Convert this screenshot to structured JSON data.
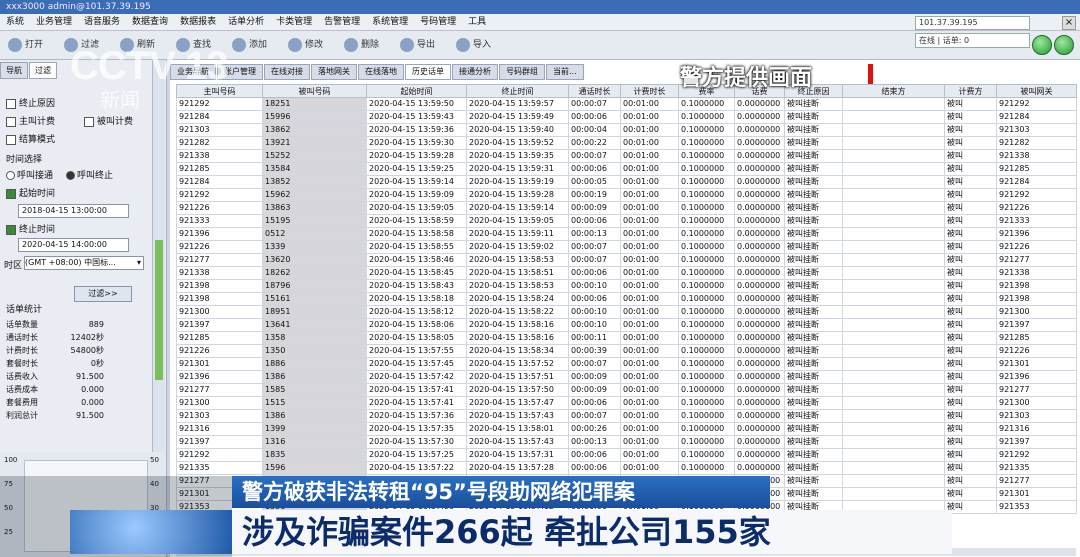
{
  "window": {
    "title": "xxx3000 admin@101.37.39.195",
    "ip": "101.37.39.195",
    "status": "在线 | 话单: 0"
  },
  "menu": [
    "系统",
    "业务管理",
    "语音服务",
    "数据查询",
    "数据报表",
    "话单分析",
    "卡类管理",
    "告警管理",
    "系统管理",
    "号码管理",
    "工具"
  ],
  "toolbar": [
    {
      "label": "打开",
      "icon": "open-icon"
    },
    {
      "label": "过滤",
      "icon": "filter-icon"
    },
    {
      "label": "刷新",
      "icon": "refresh-icon"
    },
    {
      "label": "查找",
      "icon": "search-icon"
    },
    {
      "label": "添加",
      "icon": "add-icon"
    },
    {
      "label": "修改",
      "icon": "edit-icon"
    },
    {
      "label": "删除",
      "icon": "delete-icon"
    },
    {
      "label": "导出",
      "icon": "export-icon"
    },
    {
      "label": "导入",
      "icon": "import-icon"
    }
  ],
  "left": {
    "tabs": [
      "导航",
      "过滤"
    ],
    "checks": [
      {
        "label": "终止原因",
        "checked": false
      },
      {
        "label": "主叫计费",
        "checked": false
      },
      {
        "label": "被叫计费",
        "checked": false
      },
      {
        "label": "结算模式",
        "checked": false
      }
    ],
    "time_section": "时间选择",
    "radios": [
      {
        "label": "呼叫接通",
        "on": false
      },
      {
        "label": "呼叫终止",
        "on": true
      }
    ],
    "start_label": "起始时间",
    "start_value": "2018-04-15 13:00:00",
    "end_label": "终止时间",
    "end_value": "2020-04-15 14:00:00",
    "tz_label": "时区",
    "tz_value": "(GMT +08:00) 中国标...",
    "filter_button": "过滤>>",
    "stats_title": "话单统计",
    "stats": [
      {
        "k": "话单数量",
        "v": "889"
      },
      {
        "k": "通话时长",
        "v": "12402秒"
      },
      {
        "k": "计费时长",
        "v": "54800秒"
      },
      {
        "k": "套餐时长",
        "v": "0秒"
      },
      {
        "k": "话费收入",
        "v": "91.500"
      },
      {
        "k": "话费成本",
        "v": "0.000"
      },
      {
        "k": "套餐费用",
        "v": "0.000"
      },
      {
        "k": "利润总计",
        "v": "91.500"
      }
    ],
    "gauge_left": [
      "100",
      "75",
      "50",
      "25"
    ],
    "gauge_right": [
      "50",
      "40",
      "30",
      "20"
    ]
  },
  "main": {
    "tabs": [
      "业务导航",
      "账户管理",
      "在线对接",
      "落地网关",
      "在线落地",
      "历史话单",
      "接通分析",
      "号码群组",
      "当前..."
    ],
    "active_tab": 5,
    "headers": [
      "主叫号码",
      "被叫号码",
      "起始时间",
      "终止时间",
      "通话时长",
      "计费时长",
      "费率",
      "话费",
      "终止原因",
      "结束方",
      "计费方",
      "主叫网关",
      "被叫网关"
    ],
    "rows": [
      [
        "921292",
        "18251",
        "2020-04-15 13:59:50",
        "2020-04-15 13:59:57",
        "00:00:07",
        "00:01:00",
        "0.1000000",
        "0.0000000",
        "被叫挂断",
        "",
        "被叫",
        "921292"
      ],
      [
        "921284",
        "15996",
        "2020-04-15 13:59:43",
        "2020-04-15 13:59:49",
        "00:00:06",
        "00:01:00",
        "0.1000000",
        "0.0000000",
        "被叫挂断",
        "",
        "被叫",
        "921284"
      ],
      [
        "921303",
        "13862",
        "2020-04-15 13:59:36",
        "2020-04-15 13:59:40",
        "00:00:04",
        "00:01:00",
        "0.1000000",
        "0.0000000",
        "被叫挂断",
        "",
        "被叫",
        "921303"
      ],
      [
        "921282",
        "13921",
        "2020-04-15 13:59:30",
        "2020-04-15 13:59:52",
        "00:00:22",
        "00:01:00",
        "0.1000000",
        "0.0000000",
        "被叫挂断",
        "",
        "被叫",
        "921282"
      ],
      [
        "921338",
        "15252",
        "2020-04-15 13:59:28",
        "2020-04-15 13:59:35",
        "00:00:07",
        "00:01:00",
        "0.1000000",
        "0.0000000",
        "被叫挂断",
        "",
        "被叫",
        "921338"
      ],
      [
        "921285",
        "13584",
        "2020-04-15 13:59:25",
        "2020-04-15 13:59:31",
        "00:00:06",
        "00:01:00",
        "0.1000000",
        "0.0000000",
        "被叫挂断",
        "",
        "被叫",
        "921285"
      ],
      [
        "921284",
        "13852",
        "2020-04-15 13:59:14",
        "2020-04-15 13:59:19",
        "00:00:05",
        "00:01:00",
        "0.1000000",
        "0.0000000",
        "被叫挂断",
        "",
        "被叫",
        "921284"
      ],
      [
        "921292",
        "15962",
        "2020-04-15 13:59:09",
        "2020-04-15 13:59:28",
        "00:00:19",
        "00:01:00",
        "0.1000000",
        "0.0000000",
        "被叫挂断",
        "",
        "被叫",
        "921292"
      ],
      [
        "921226",
        "13863",
        "2020-04-15 13:59:05",
        "2020-04-15 13:59:14",
        "00:00:09",
        "00:01:00",
        "0.1000000",
        "0.0000000",
        "被叫挂断",
        "",
        "被叫",
        "921226"
      ],
      [
        "921333",
        "15195",
        "2020-04-15 13:58:59",
        "2020-04-15 13:59:05",
        "00:00:06",
        "00:01:00",
        "0.1000000",
        "0.0000000",
        "被叫挂断",
        "",
        "被叫",
        "921333"
      ],
      [
        "921396",
        "0512",
        "2020-04-15 13:58:58",
        "2020-04-15 13:59:11",
        "00:00:13",
        "00:01:00",
        "0.1000000",
        "0.0000000",
        "被叫挂断",
        "",
        "被叫",
        "921396"
      ],
      [
        "921226",
        "1339",
        "2020-04-15 13:58:55",
        "2020-04-15 13:59:02",
        "00:00:07",
        "00:01:00",
        "0.1000000",
        "0.0000000",
        "被叫挂断",
        "",
        "被叫",
        "921226"
      ],
      [
        "921277",
        "13620",
        "2020-04-15 13:58:46",
        "2020-04-15 13:58:53",
        "00:00:07",
        "00:01:00",
        "0.1000000",
        "0.0000000",
        "被叫挂断",
        "",
        "被叫",
        "921277"
      ],
      [
        "921338",
        "18262",
        "2020-04-15 13:58:45",
        "2020-04-15 13:58:51",
        "00:00:06",
        "00:01:00",
        "0.1000000",
        "0.0000000",
        "被叫挂断",
        "",
        "被叫",
        "921338"
      ],
      [
        "921398",
        "18796",
        "2020-04-15 13:58:43",
        "2020-04-15 13:58:53",
        "00:00:10",
        "00:01:00",
        "0.1000000",
        "0.0000000",
        "被叫挂断",
        "",
        "被叫",
        "921398"
      ],
      [
        "921398",
        "15161",
        "2020-04-15 13:58:18",
        "2020-04-15 13:58:24",
        "00:00:06",
        "00:01:00",
        "0.1000000",
        "0.0000000",
        "被叫挂断",
        "",
        "被叫",
        "921398"
      ],
      [
        "921300",
        "18951",
        "2020-04-15 13:58:12",
        "2020-04-15 13:58:22",
        "00:00:10",
        "00:01:00",
        "0.1000000",
        "0.0000000",
        "被叫挂断",
        "",
        "被叫",
        "921300"
      ],
      [
        "921397",
        "13641",
        "2020-04-15 13:58:06",
        "2020-04-15 13:58:16",
        "00:00:10",
        "00:01:00",
        "0.1000000",
        "0.0000000",
        "被叫挂断",
        "",
        "被叫",
        "921397"
      ],
      [
        "921285",
        "1358",
        "2020-04-15 13:58:05",
        "2020-04-15 13:58:16",
        "00:00:11",
        "00:01:00",
        "0.1000000",
        "0.0000000",
        "被叫挂断",
        "",
        "被叫",
        "921285"
      ],
      [
        "921226",
        "1350",
        "2020-04-15 13:57:55",
        "2020-04-15 13:58:34",
        "00:00:39",
        "00:01:00",
        "0.1000000",
        "0.0000000",
        "被叫挂断",
        "",
        "被叫",
        "921226"
      ],
      [
        "921301",
        "1886",
        "2020-04-15 13:57:45",
        "2020-04-15 13:57:52",
        "00:00:07",
        "00:01:00",
        "0.1000000",
        "0.0000000",
        "被叫挂断",
        "",
        "被叫",
        "921301"
      ],
      [
        "921396",
        "1386",
        "2020-04-15 13:57:42",
        "2020-04-15 13:57:51",
        "00:00:09",
        "00:01:00",
        "0.1000000",
        "0.0000000",
        "被叫挂断",
        "",
        "被叫",
        "921396"
      ],
      [
        "921277",
        "1585",
        "2020-04-15 13:57:41",
        "2020-04-15 13:57:50",
        "00:00:09",
        "00:01:00",
        "0.1000000",
        "0.0000000",
        "被叫挂断",
        "",
        "被叫",
        "921277"
      ],
      [
        "921300",
        "1515",
        "2020-04-15 13:57:41",
        "2020-04-15 13:57:47",
        "00:00:06",
        "00:01:00",
        "0.1000000",
        "0.0000000",
        "被叫挂断",
        "",
        "被叫",
        "921300"
      ],
      [
        "921303",
        "1386",
        "2020-04-15 13:57:36",
        "2020-04-15 13:57:43",
        "00:00:07",
        "00:01:00",
        "0.1000000",
        "0.0000000",
        "被叫挂断",
        "",
        "被叫",
        "921303"
      ],
      [
        "921316",
        "1399",
        "2020-04-15 13:57:35",
        "2020-04-15 13:58:01",
        "00:00:26",
        "00:01:00",
        "0.1000000",
        "0.0000000",
        "被叫挂断",
        "",
        "被叫",
        "921316"
      ],
      [
        "921397",
        "1316",
        "2020-04-15 13:57:30",
        "2020-04-15 13:57:43",
        "00:00:13",
        "00:01:00",
        "0.1000000",
        "0.0000000",
        "被叫挂断",
        "",
        "被叫",
        "921397"
      ],
      [
        "921292",
        "1835",
        "2020-04-15 13:57:25",
        "2020-04-15 13:57:31",
        "00:00:06",
        "00:01:00",
        "0.1000000",
        "0.0000000",
        "被叫挂断",
        "",
        "被叫",
        "921292"
      ],
      [
        "921335",
        "1596",
        "2020-04-15 13:57:22",
        "2020-04-15 13:57:28",
        "00:00:06",
        "00:01:00",
        "0.1000000",
        "0.0000000",
        "被叫挂断",
        "",
        "被叫",
        "921335"
      ],
      [
        "921277",
        "1513",
        "2020-04-15 13:57:17",
        "2020-04-15 13:57:25",
        "00:00:08",
        "00:01:00",
        "0.1000000",
        "0.0000000",
        "被叫挂断",
        "",
        "被叫",
        "921277"
      ],
      [
        "921301",
        "1505",
        "2020-04-15 13:57:10",
        "2020-04-15 13:57:19",
        "00:00:09",
        "00:01:00",
        "0.1000000",
        "0.0000000",
        "被叫挂断",
        "",
        "被叫",
        "921301"
      ],
      [
        "921353",
        "1396",
        "2020-04-15 13:57:06",
        "2020-04-15 13:57:12",
        "00:00:06",
        "00:01:00",
        "0.1000000",
        "0.0000000",
        "被叫挂断",
        "",
        "被叫",
        "921353"
      ]
    ]
  },
  "overlay": {
    "logo": "CCTV 13",
    "logo_sub": "新闻",
    "caption": "警方提供画面",
    "headline1": "警方破获非法转租“95”号段助网络犯罪案",
    "headline2": "涉及诈骗案件266起 牵扯公司155家",
    "accent": "#e01010"
  }
}
